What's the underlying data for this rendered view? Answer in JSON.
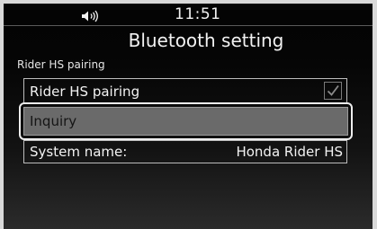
{
  "status_bar": {
    "volume_icon": "speaker-volume-icon",
    "time": "11:51"
  },
  "header": {
    "title": "Bluetooth setting"
  },
  "section": {
    "label": "Rider HS pairing"
  },
  "rows": {
    "pairing": {
      "label": "Rider HS pairing",
      "checked": true,
      "checkbox_icon": "checkmark-icon"
    },
    "inquiry": {
      "label": "Inquiry",
      "selected": true
    },
    "system_name": {
      "label": "System name:",
      "value": "Honda Rider HS"
    }
  },
  "colors": {
    "background": "#050505",
    "text": "#f2f2f2",
    "selected_fill": "#6a6a6a",
    "row_border": "#bdbdbd",
    "focus_ring": "#ededed"
  }
}
